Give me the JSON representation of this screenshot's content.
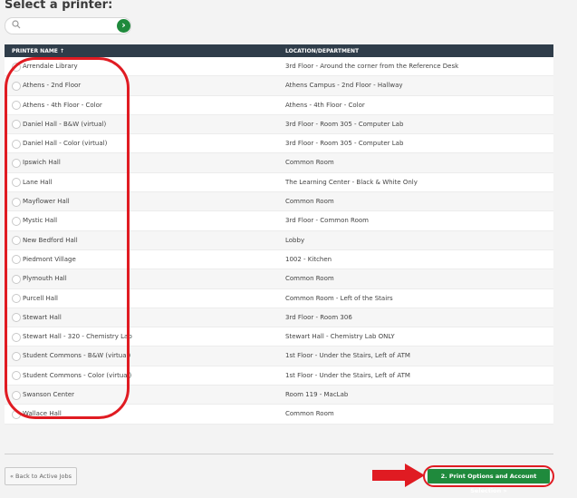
{
  "page": {
    "title": "Select a printer:"
  },
  "search": {
    "placeholder": "",
    "go_label": "›"
  },
  "table": {
    "columns": [
      "PRINTER NAME ↑",
      "LOCATION/DEPARTMENT"
    ],
    "rows": [
      {
        "name": "Arrendale Library",
        "location": "3rd Floor - Around the corner from the Reference Desk"
      },
      {
        "name": "Athens - 2nd Floor",
        "location": "Athens Campus - 2nd Floor - Hallway"
      },
      {
        "name": "Athens - 4th Floor - Color",
        "location": "Athens - 4th Floor - Color"
      },
      {
        "name": "Daniel Hall - B&W (virtual)",
        "location": "3rd Floor - Room 305 - Computer Lab"
      },
      {
        "name": "Daniel Hall - Color (virtual)",
        "location": "3rd Floor - Room 305 - Computer Lab"
      },
      {
        "name": "Ipswich Hall",
        "location": "Common Room"
      },
      {
        "name": "Lane Hall",
        "location": "The Learning Center - Black & White Only"
      },
      {
        "name": "Mayflower Hall",
        "location": "Common Room"
      },
      {
        "name": "Mystic Hall",
        "location": "3rd Floor - Common Room"
      },
      {
        "name": "New Bedford Hall",
        "location": "Lobby"
      },
      {
        "name": "Piedmont Village",
        "location": "1002 - Kitchen"
      },
      {
        "name": "Plymouth Hall",
        "location": "Common Room"
      },
      {
        "name": "Purcell Hall",
        "location": "Common Room - Left of the Stairs"
      },
      {
        "name": "Stewart Hall",
        "location": "3rd Floor - Room 306"
      },
      {
        "name": "Stewart Hall - 320 - Chemistry Lab",
        "location": "Stewart Hall - Chemistry Lab ONLY"
      },
      {
        "name": "Student Commons - B&W (virtual)",
        "location": "1st Floor - Under the Stairs, Left of ATM"
      },
      {
        "name": "Student Commons - Color (virtual)",
        "location": "1st Floor - Under the Stairs, Left of ATM"
      },
      {
        "name": "Swanson Center",
        "location": "Room 119 - MacLab"
      },
      {
        "name": "Wallace Hall",
        "location": "Common Room"
      }
    ]
  },
  "footer": {
    "back_label": "« Back to Active Jobs",
    "print_label": "2. Print Options and Account Selection »"
  },
  "colors": {
    "accent_green": "#1f8a3c",
    "header_dark": "#2f3d4a",
    "annotation_red": "#e01b22"
  },
  "icons": {
    "search": "search-icon",
    "go": "chevron-right-icon",
    "arrow": "arrow-right-icon"
  }
}
